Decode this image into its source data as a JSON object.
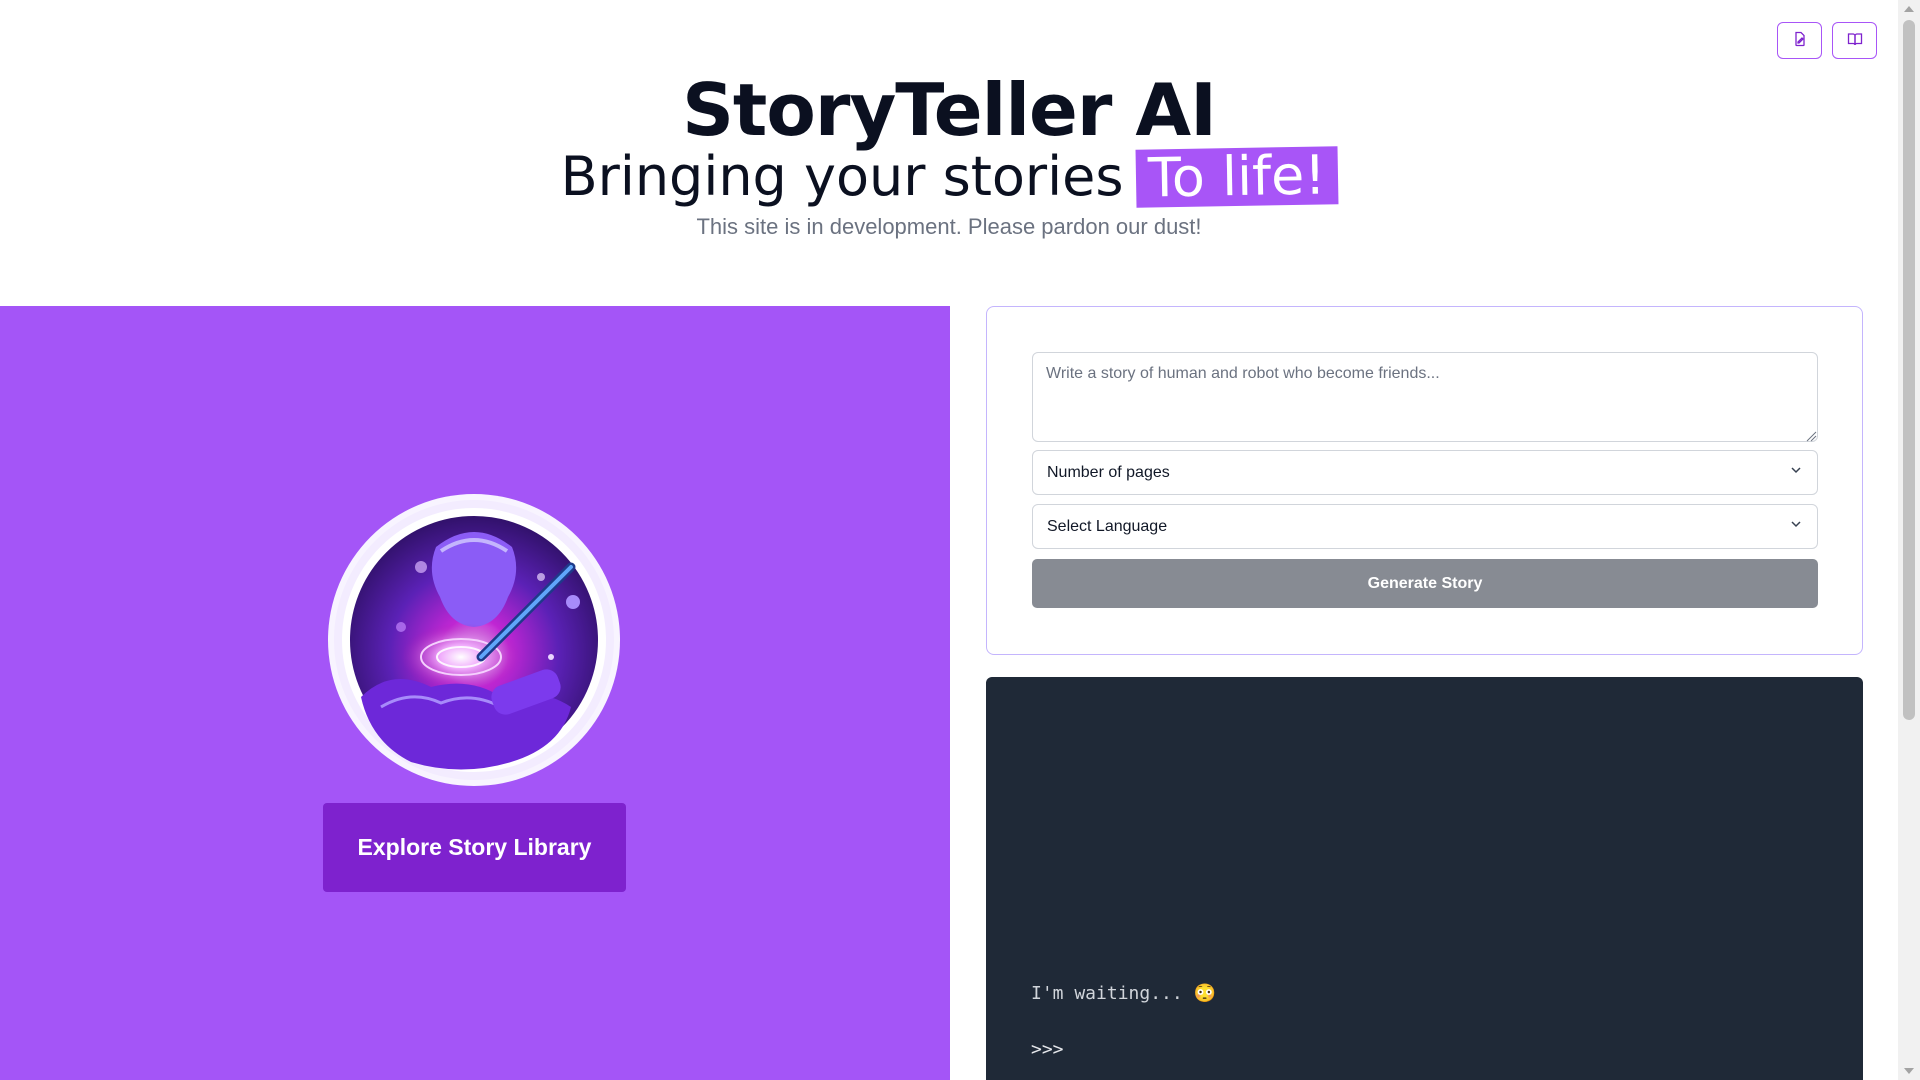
{
  "header": {
    "title": "StoryTeller AI",
    "subtitle_prefix": "Bringing your stories",
    "subtitle_highlight": "To life!",
    "notice": "This site is in development. Please pardon our dust!"
  },
  "top_actions": [
    {
      "name": "document-edit-icon"
    },
    {
      "name": "book-open-icon"
    }
  ],
  "left_panel": {
    "explore_label": "Explore Story Library",
    "logo": "storyteller-logo"
  },
  "form": {
    "prompt_placeholder": "Write a story of human and robot who become friends...",
    "pages_select": "Number of pages",
    "language_select": "Select Language",
    "generate_label": "Generate Story"
  },
  "console": {
    "status": "I'm waiting... 😳",
    "prompt_symbol": ">>>"
  },
  "colors": {
    "accent": "#a855f7",
    "accent_dark": "#7e22ce",
    "panel": "#a455f7",
    "console_bg": "#1f2937",
    "button_disabled": "#878b93"
  }
}
